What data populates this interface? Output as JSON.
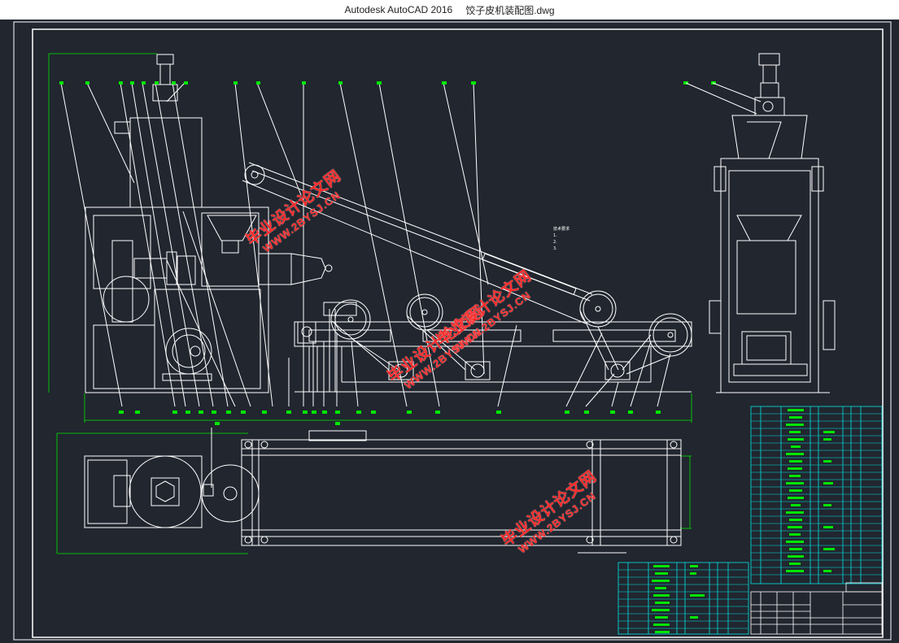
{
  "window": {
    "app_title": "Autodesk AutoCAD 2016",
    "file_name": "饺子皮机装配图.dwg"
  },
  "watermarks": [
    {
      "text": "毕业设计论文网",
      "url": "WWW.2BYSJ.CN"
    },
    {
      "text": "毕业设计论文网",
      "url": "WWW.2BYSJ.CN"
    },
    {
      "text": "毕业设计论文网",
      "url": "WWW.2BYSJ.CN"
    },
    {
      "text": "毕业设计论文网",
      "url": "WWW.2BYSJ.CN"
    }
  ],
  "notes": {
    "title": "技术要求",
    "lines": [
      "1.",
      "2.",
      "3."
    ]
  },
  "colors": {
    "background": "#21262f",
    "line": "#ffffff",
    "table": "#00e5e5",
    "dimension": "#00e600",
    "watermark": "#ff2a2a"
  }
}
